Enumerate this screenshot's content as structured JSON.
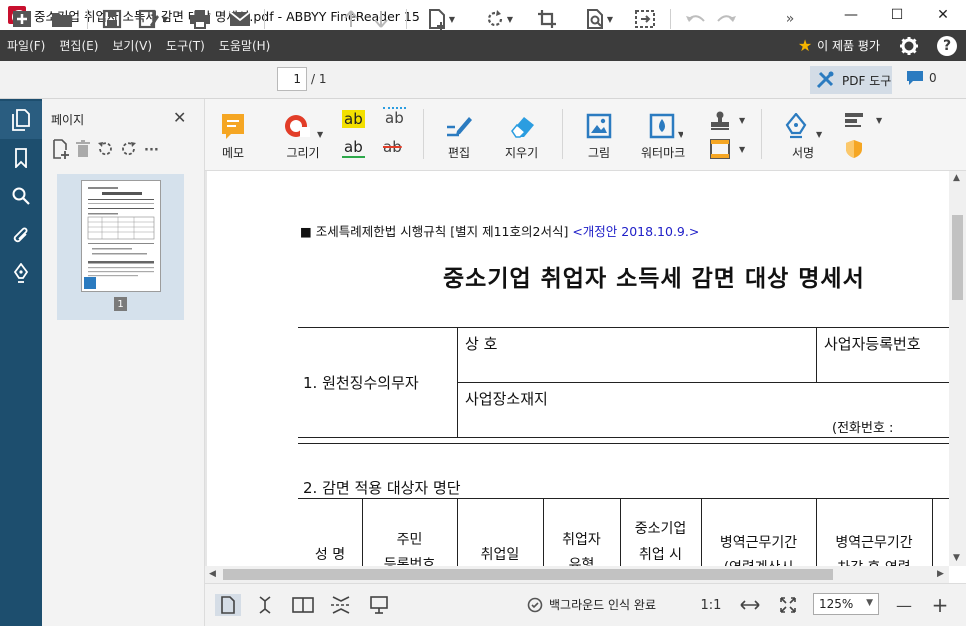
{
  "window": {
    "title": "중소기업 취업자 소득세 감면 대상 명세서.pdf - ABBYY FineReader 15",
    "minimize": "—",
    "maximize": "☐",
    "close": "✕"
  },
  "menu": {
    "items": [
      "파일(F)",
      "편집(E)",
      "보기(V)",
      "도구(T)",
      "도움말(H)"
    ],
    "rate_label": "이 제품 평가",
    "help": "?"
  },
  "toolbar": {
    "page_current": "1",
    "page_total": "/ 1",
    "overflow": "»",
    "pdf_tools_label": "PDF 도구",
    "comment_count": "0"
  },
  "pages_panel": {
    "title": "페이지",
    "close": "✕",
    "more": "···",
    "thumbnail_page_number": "1"
  },
  "ribbon": {
    "memo": "메모",
    "draw": "그리기",
    "highlight_text": "ab",
    "underline_text": "ab",
    "insert_text": "ab",
    "strike_text": "ab",
    "edit": "편집",
    "erase": "지우기",
    "picture": "그림",
    "watermark": "워터마크",
    "signature": "서명"
  },
  "document": {
    "law_reference": "■ 조세특례제한법 시행규칙 [별지 제11호의2서식]",
    "revision": "<개정안 2018.10.9.>",
    "title": "중소기업 취업자 소득세 감면 대상 명세서",
    "section1_label": "1. 원천징수의무자",
    "trade_name": "상  호",
    "business_reg_no": "사업자등록번호",
    "business_address": "사업장소재지",
    "phone": "(전화번호 :",
    "section2_title": "2. 감면 적용 대상자 명단",
    "columns": {
      "name": "성  명",
      "resident_no": [
        "주민",
        "등록번호"
      ],
      "hire_date": "취업일",
      "eligibility": [
        "취업자",
        "유형"
      ],
      "sme_employment": [
        "중소기업",
        "취업 시"
      ],
      "military_period": [
        "병역근무기간",
        "(연령계산시"
      ],
      "military_after": [
        "병역근무기간",
        "차감 후 연령"
      ]
    }
  },
  "status": {
    "background_recognition": "백그라운드 인식 완료",
    "ratio": "1:1",
    "zoom": "125%",
    "zoom_out": "—",
    "zoom_in": "+"
  }
}
